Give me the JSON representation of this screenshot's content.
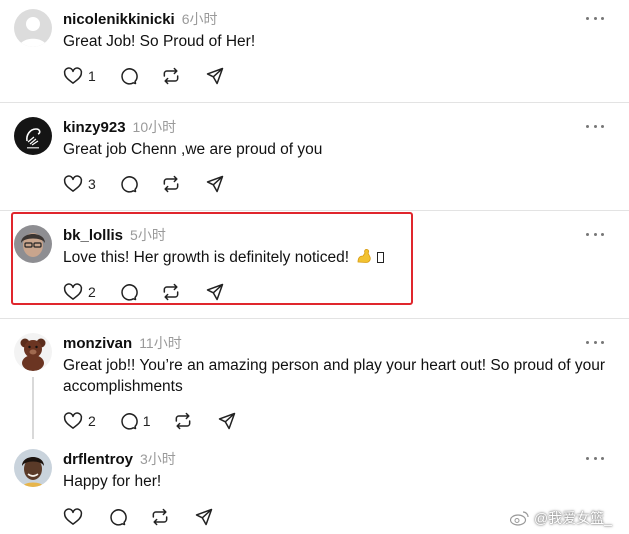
{
  "posts": [
    {
      "username": "nicolenikkinicki",
      "time": "6小时",
      "text": "Great Job! So Proud of Her!",
      "like_count": "1",
      "reply_count": ""
    },
    {
      "username": "kinzy923",
      "time": "10小时",
      "text": "Great job Chenn ,we are proud of you",
      "like_count": "3",
      "reply_count": ""
    },
    {
      "username": "bk_lollis",
      "time": "5小时",
      "text": "Love this! Her growth is definitely noticed!",
      "emoji_icon": "flexed-biceps-emoji",
      "like_count": "2",
      "reply_count": ""
    },
    {
      "username": "monzivan",
      "time": "11小时",
      "text": "Great job!! You’re an amazing person and play your heart out! So proud of your accomplishments",
      "like_count": "2",
      "reply_count": "1"
    },
    {
      "username": "drflentroy",
      "time": "3小时",
      "text": "Happy for her!",
      "like_count": "",
      "reply_count": ""
    }
  ],
  "icons": {
    "like": "heart-icon",
    "reply": "comment-icon",
    "repost": "repost-icon",
    "share": "send-icon",
    "more": "more-icon"
  },
  "colors": {
    "highlight_border": "#e0262d",
    "muted_text": "#9a9a9a",
    "divider": "#e3e3e3"
  },
  "watermark": {
    "text": "@我爱女篮_",
    "icon": "weibo-logo"
  }
}
